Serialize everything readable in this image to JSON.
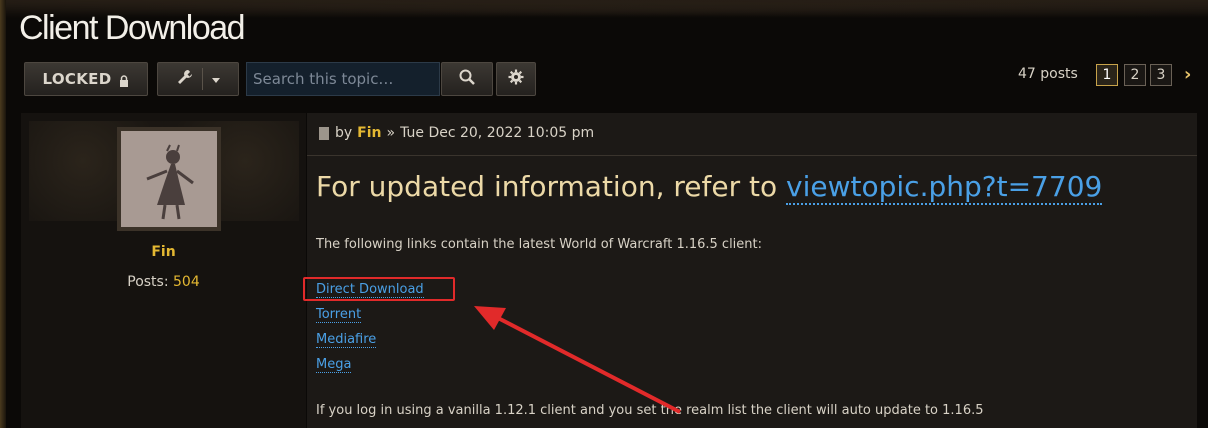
{
  "page": {
    "title": "Client Download"
  },
  "toolbar": {
    "locked_label": "LOCKED",
    "search_placeholder": "Search this topic…",
    "post_count": "47 posts",
    "pages": [
      "1",
      "2",
      "3"
    ],
    "current_page": "1"
  },
  "author": {
    "name": "Fin",
    "posts_label": "Posts:",
    "posts_count": "504"
  },
  "post": {
    "by_label": "by",
    "author": "Fin",
    "separator": "»",
    "timestamp": "Tue Dec 20, 2022 10:05 pm",
    "headline_text": "For updated information, refer to",
    "headline_link": "viewtopic.php?t=7709",
    "intro": "The following links contain the latest World of Warcraft 1.16.5 client:",
    "links": [
      "Direct Download",
      "Torrent",
      "Mediafire",
      "Mega"
    ],
    "outro": "If you log in using a vanilla 1.12.1 client and you set the realm list the client will auto update to 1.16.5"
  },
  "colors": {
    "accent_gold": "#e4b832",
    "link_blue": "#4aa0e6",
    "annotation_red": "#e12a2a"
  }
}
